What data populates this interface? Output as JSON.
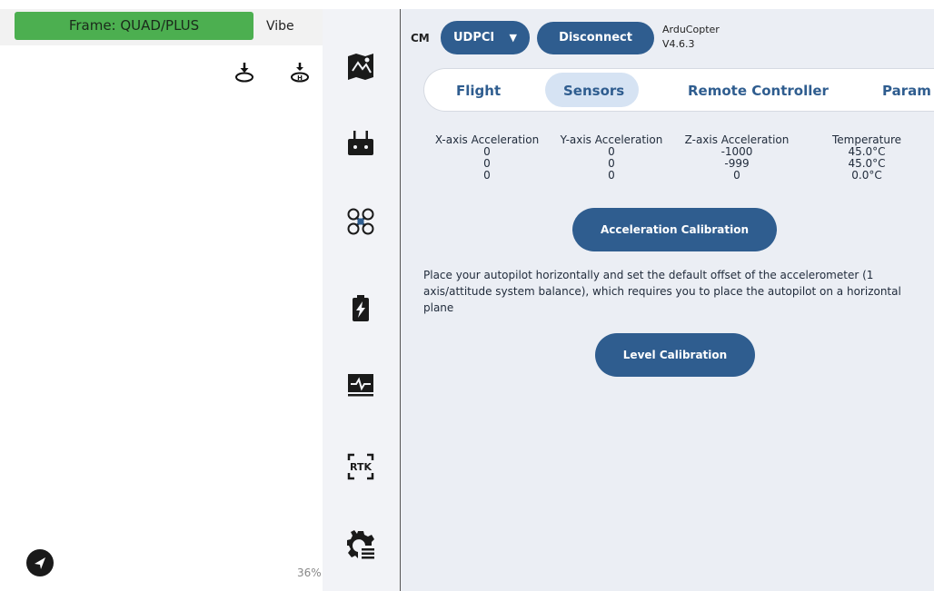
{
  "left_panel": {
    "frame_label": "Frame: QUAD/PLUS",
    "vibe_label": "Vibe",
    "percent_text": "36%"
  },
  "rail": {
    "items": [
      {
        "icon": "map-icon"
      },
      {
        "icon": "remote-controller-icon"
      },
      {
        "icon": "drone-frame-icon"
      },
      {
        "icon": "battery-icon"
      },
      {
        "icon": "monitor-pulse-icon"
      },
      {
        "icon": "rtk-icon",
        "label": "RTK"
      },
      {
        "icon": "settings-gear-icon"
      }
    ]
  },
  "connection": {
    "cm_label": "CM",
    "port_value": "UDPCI",
    "disconnect_label": "Disconnect",
    "firmware_name": "ArduCopter",
    "firmware_version": "V4.6.3"
  },
  "tabs": [
    {
      "label": "Flight",
      "active": false
    },
    {
      "label": "Sensors",
      "active": true
    },
    {
      "label": "Remote Controller",
      "active": false
    },
    {
      "label": "Param",
      "active": false
    }
  ],
  "sensor_table": {
    "headers": [
      "X-axis Acceleration",
      "Y-axis Acceleration",
      "Z-axis Acceleration",
      "Temperature"
    ],
    "rows": [
      [
        "0",
        "0",
        "-1000",
        "45.0°C"
      ],
      [
        "0",
        "0",
        "-999",
        "45.0°C"
      ],
      [
        "0",
        "0",
        "0",
        "0.0°C"
      ]
    ]
  },
  "calibration": {
    "acceleration_button": "Acceleration Calibration",
    "instruction": "Place your autopilot horizontally and set the default offset of the accelerometer (1 axis/attitude system balance), which requires you to place the autopilot on a horizontal plane",
    "level_button": "Level Calibration"
  },
  "colors": {
    "accent": "#2f5d8f",
    "frame_badge": "#4caf50",
    "tab_active_bg": "#d6e3f3"
  }
}
